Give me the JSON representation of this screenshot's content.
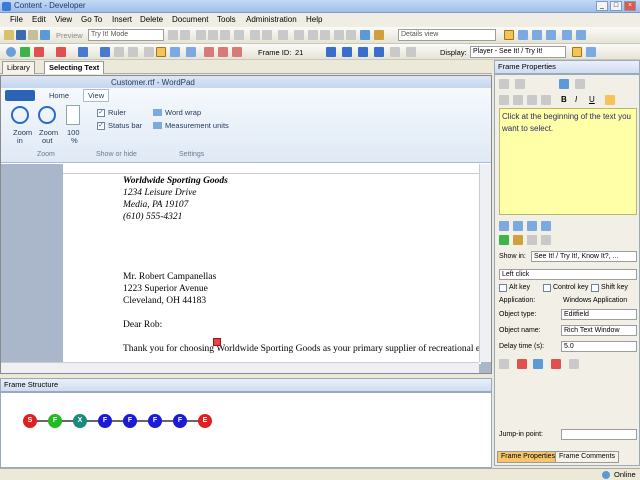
{
  "window": {
    "title": "Content - Developer"
  },
  "menu": [
    "File",
    "Edit",
    "View",
    "Go To",
    "Insert",
    "Delete",
    "Document",
    "Tools",
    "Administration",
    "Help"
  ],
  "toolbar": {
    "preview_label": "Preview",
    "mode_value": "Try It! Mode",
    "view_value": "Details view",
    "frame_id_label": "Frame ID:",
    "frame_id_value": "21",
    "display_label": "Display:",
    "display_value": "Player - See It! / Try It!"
  },
  "tabs": [
    {
      "label": "Library"
    },
    {
      "label": "Selecting Text"
    }
  ],
  "wordpad": {
    "title": "Customer.rtf - WordPad",
    "ribbon_tabs": [
      "Home",
      "View"
    ],
    "zoom_in": [
      "Zoom",
      "in"
    ],
    "zoom_out": [
      "Zoom",
      "out"
    ],
    "percent": [
      "100",
      "%"
    ],
    "zoom_group": "Zoom",
    "ruler_label": "Ruler",
    "statusbar_label": "Status bar",
    "show_hide_group": "Show or hide",
    "word_wrap": "Word wrap",
    "measurement_units": "Measurement units",
    "settings_group": "Settings",
    "doc_lines": [
      "Worldwide Sporting Goods",
      "1234 Leisure Drive",
      "Media, PA 19107",
      "(610) 555-4321",
      "Mr. Robert Campanellas",
      "1223 Superior Avenue",
      "Cleveland, OH  44183",
      "Dear Rob:",
      "Thank you for choosing Worldwide Sporting Goods as your primary supplier of recreational eq"
    ]
  },
  "frame_structure": {
    "title": "Frame Structure",
    "nodes": [
      {
        "letter": "S",
        "color": "#e02020"
      },
      {
        "letter": "F",
        "color": "#22bb22"
      },
      {
        "letter": "X",
        "color": "#1a8a7a"
      },
      {
        "letter": "F",
        "color": "#1a1ad8"
      },
      {
        "letter": "F",
        "color": "#1a1ad8"
      },
      {
        "letter": "F",
        "color": "#1a1ad8"
      },
      {
        "letter": "F",
        "color": "#1a1ad8"
      },
      {
        "letter": "E",
        "color": "#e02020"
      }
    ]
  },
  "frame_properties": {
    "title": "Frame Properties",
    "instruction": "Click at the beginning of the text you want to select.",
    "show_in_label": "Show in:",
    "show_in_value": "See It! / Try It!, Know It?, ...",
    "action_value": "Left click",
    "alt_key": "Alt key",
    "control_key": "Control key",
    "shift_key": "Shift key",
    "application_label": "Application:",
    "application_value": "Windows Application",
    "object_type_label": "Object type:",
    "object_type_value": "Editfield",
    "object_name_label": "Object name:",
    "object_name_value": "Rich Text Window",
    "delay_label": "Delay time (s):",
    "delay_value": "5.0",
    "jump_label": "Jump-in point:",
    "bottom_tabs": [
      "Frame Properties",
      "Frame Comments"
    ]
  },
  "status": {
    "online": "Online"
  }
}
